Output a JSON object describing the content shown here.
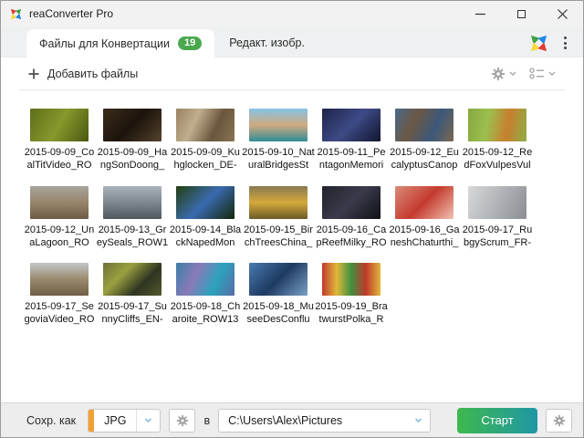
{
  "window": {
    "title": "reaConverter Pro"
  },
  "tabs": {
    "files": {
      "label": "Файлы для Конвертации",
      "badge": "19"
    },
    "edit": {
      "label": "Редакт. изобр."
    }
  },
  "toolbar": {
    "add_files_label": "Добавить файлы"
  },
  "icons": {
    "app_logo": "pinwheel-4color",
    "brand": "pinwheel-4color",
    "menu": "kebab-vertical",
    "add": "plus",
    "settings": "gear",
    "view_mode": "thumbnail-list",
    "dropdown": "chevron-down",
    "minimize": "–",
    "maximize": "□",
    "close": "✕"
  },
  "files": [
    {
      "name": "2015-09-09_CoalTitVideo_RO",
      "dir": "120deg",
      "colors": [
        "#5e6e1a",
        "#87982c",
        "#49570f"
      ]
    },
    {
      "name": "2015-09-09_HangSonDoong_",
      "dir": "135deg",
      "colors": [
        "#3c2c1c",
        "#1c140c",
        "#54422e"
      ]
    },
    {
      "name": "2015-09-09_Kuhglocken_DE-",
      "dir": "115deg",
      "colors": [
        "#9a8262",
        "#c0ae8e",
        "#6b563c",
        "#8a7456"
      ]
    },
    {
      "name": "2015-09-10_NaturalBridgesSt",
      "dir": "180deg",
      "colors": [
        "#85c3e8",
        "#d0aa7e",
        "#2f8c96"
      ]
    },
    {
      "name": "2015-09-11_PentagonMemori",
      "dir": "135deg",
      "colors": [
        "#1e2448",
        "#3d4a86",
        "#12152e"
      ]
    },
    {
      "name": "2015-09-12_EucalyptusCanop",
      "dir": "115deg",
      "colors": [
        "#4a688c",
        "#6b5844",
        "#3c587a",
        "#7a6850"
      ]
    },
    {
      "name": "2015-09-12_RedFoxVulpesVul",
      "dir": "100deg",
      "colors": [
        "#86a83e",
        "#9cbf4f",
        "#c77f2e",
        "#8fae45"
      ]
    },
    {
      "name": "2015-09-12_UnaLagoon_RO",
      "dir": "180deg",
      "colors": [
        "#a8a49c",
        "#97856a",
        "#6b5c44"
      ]
    },
    {
      "name": "2015-09-13_GreySeals_ROW1",
      "dir": "180deg",
      "colors": [
        "#aab2ba",
        "#7e868e",
        "#4e565e"
      ]
    },
    {
      "name": "2015-09-14_BlackNapedMon",
      "dir": "135deg",
      "colors": [
        "#23400f",
        "#3a6ab0",
        "#132608"
      ]
    },
    {
      "name": "2015-09-15_BirchTreesChina_",
      "dir": "180deg",
      "colors": [
        "#8a7a52",
        "#d4a93c",
        "#6b5a28"
      ]
    },
    {
      "name": "2015-09-16_CapReefMilky_RO",
      "dir": "135deg",
      "colors": [
        "#23232e",
        "#3a3a4a",
        "#101016"
      ]
    },
    {
      "name": "2015-09-16_GaneshChaturthi_",
      "dir": "135deg",
      "colors": [
        "#d98a78",
        "#c43b2e",
        "#f0c2b2"
      ]
    },
    {
      "name": "2015-09-17_RubgyScrum_FR-",
      "dir": "115deg",
      "colors": [
        "#d8d8d8",
        "#b0b4b8",
        "#8a8e94"
      ]
    },
    {
      "name": "2015-09-17_SegoviaVideo_RO",
      "dir": "180deg",
      "colors": [
        "#c2c6ca",
        "#9a8a6e",
        "#6e5e46"
      ]
    },
    {
      "name": "2015-09-17_SunnyCliffs_EN-",
      "dir": "135deg",
      "colors": [
        "#6e7038",
        "#9aa040",
        "#2e3420",
        "#55592e"
      ]
    },
    {
      "name": "2015-09-18_Charoite_ROW13",
      "dir": "115deg",
      "colors": [
        "#3b7fa8",
        "#8a7ab8",
        "#2ba2bc",
        "#5a6aa8"
      ]
    },
    {
      "name": "2015-09-18_MuseeDesConflu",
      "dir": "135deg",
      "colors": [
        "#4a7ab0",
        "#1e3a60",
        "#7aa0c8"
      ]
    },
    {
      "name": "2015-09-19_BratwurstPolka_R",
      "dir": "90deg",
      "colors": [
        "#c0392b",
        "#e0b83a",
        "#3f8f3f",
        "#c0392b",
        "#e0b83a"
      ]
    }
  ],
  "footer": {
    "save_as_label": "Сохр. как",
    "format_value": "JPG",
    "in_label": "в",
    "path_value": "C:\\Users\\Alex\\Pictures",
    "start_label": "Старт"
  },
  "colors": {
    "badge_green": "#4aa94e",
    "start_gradient_left": "#3eb84d",
    "start_gradient_right": "#1f97a5",
    "format_accent_orange": "#f2a02f",
    "logo_green": "#43a047",
    "logo_blue": "#1e88e5",
    "logo_yellow": "#fdd835",
    "logo_red": "#e53935"
  }
}
